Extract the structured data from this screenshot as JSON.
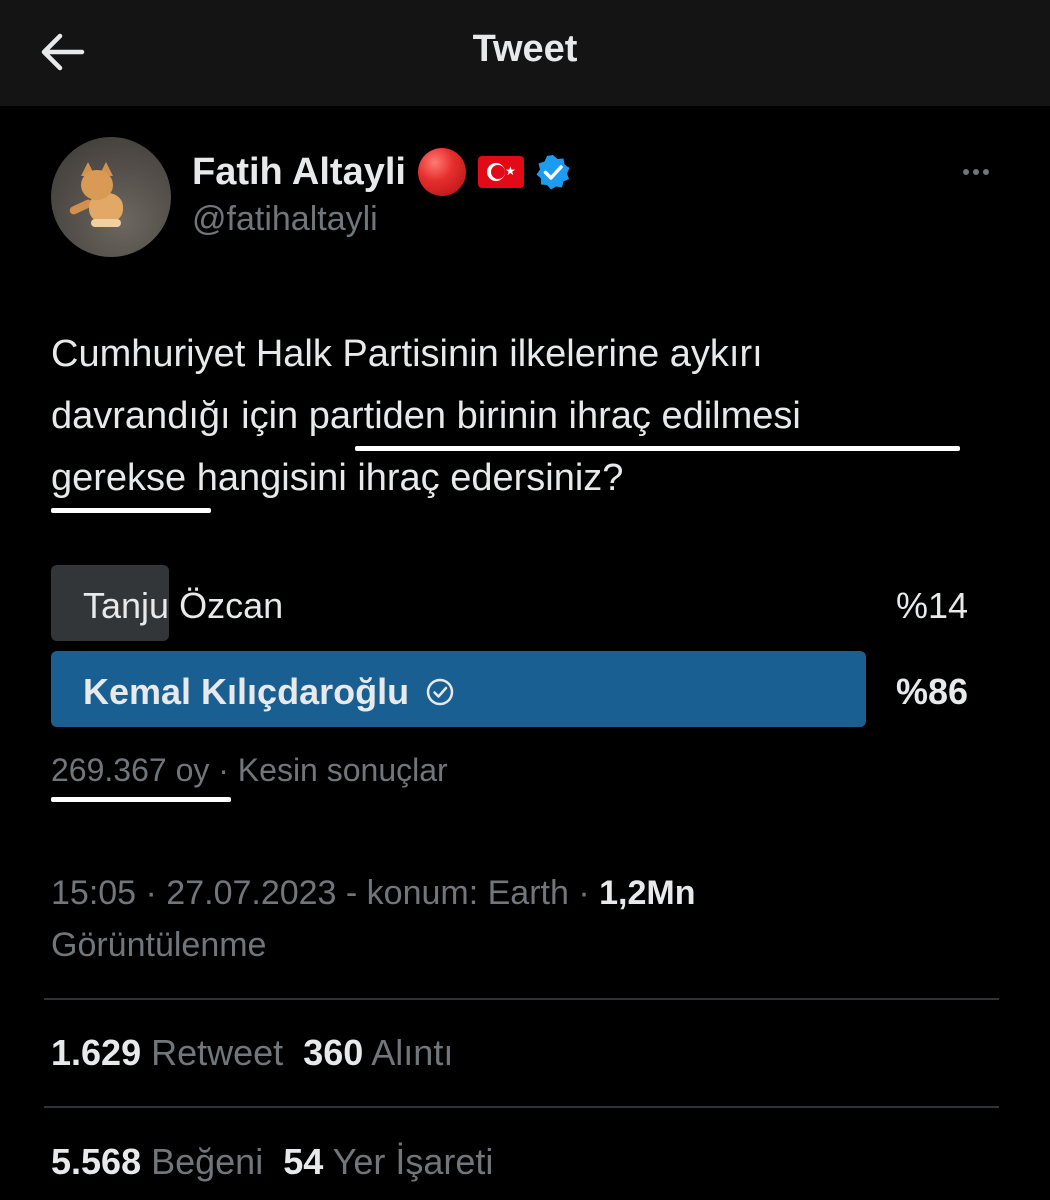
{
  "header": {
    "title": "Tweet"
  },
  "author": {
    "display_name": "Fatih Altayli",
    "handle": "@fatihaltayli"
  },
  "tweet": {
    "text_part1": "Cumhuriyet Halk Partisinin ilkelerine aykırı",
    "text_part2a": "davrandığı için ",
    "text_part2b": "partiden birinin ihraç edilmesi",
    "text_part3a": "gerekse",
    "text_part3b": " hangisini ihraç edersiniz?"
  },
  "poll": {
    "options": [
      {
        "label": "Tanju Özcan",
        "percent_label": "%14",
        "percent": 14,
        "winner": false
      },
      {
        "label": "Kemal Kılıçdaroğlu",
        "percent_label": "%86",
        "percent": 86,
        "winner": true
      }
    ],
    "votes": "269.367 oy",
    "separator": " · ",
    "status": "Kesin sonuçlar"
  },
  "meta": {
    "timestamp": "15:05 · 27.07.2023 - konum: Earth · ",
    "views_count": "1,2Mn",
    "views_label": "Görüntülenme"
  },
  "stats": {
    "retweets": "1.629",
    "retweets_label": " Retweet",
    "quotes": "360",
    "quotes_label": " Alıntı",
    "likes": "5.568",
    "likes_label": " Beğeni",
    "bookmarks": "54",
    "bookmarks_label": " Yer İşareti"
  },
  "colors": {
    "background": "#000000",
    "poll_winner": "#1a5f92",
    "poll_other": "#333639",
    "verified": "#1d9bf0",
    "muted_text": "#71767b"
  },
  "icons": [
    "back-arrow-icon",
    "red-circle-emoji",
    "turkey-flag-emoji",
    "verified-badge-icon",
    "more-options-icon",
    "check-circle-icon"
  ]
}
